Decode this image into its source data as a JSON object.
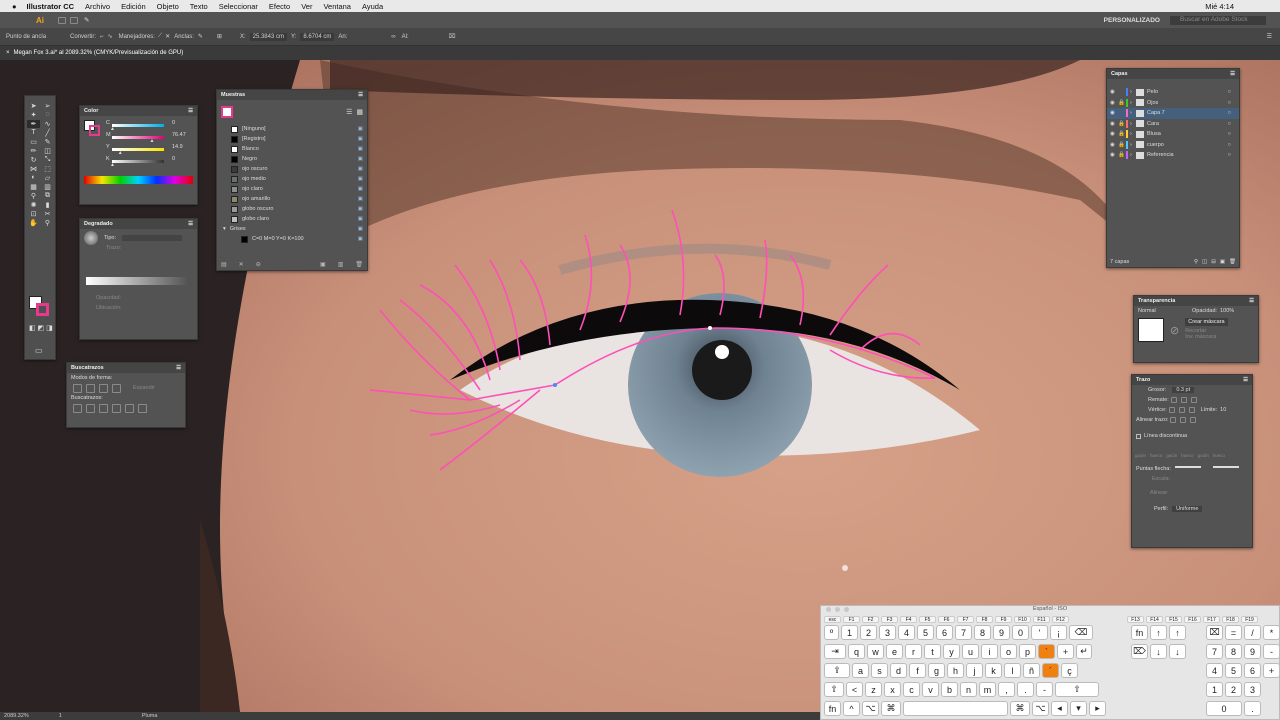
{
  "menubar": {
    "app": "Illustrator CC",
    "items": [
      "Archivo",
      "Edición",
      "Objeto",
      "Texto",
      "Seleccionar",
      "Efecto",
      "Ver",
      "Ventana",
      "Ayuda"
    ],
    "clock": "Mié 4:14"
  },
  "ctrlbar": {
    "app_icon": "Ai",
    "workspace": "PERSONALIZADO",
    "stock_placeholder": "Buscar en Adobe Stock"
  },
  "optbar": {
    "anchor_label": "Punto de ancla",
    "convert_label": "Convertir:",
    "handles_label": "Manejadores:",
    "anchors_label": "Anclas:",
    "x_label": "X:",
    "x_value": "25.3843 cm",
    "y_label": "Y:",
    "y_value": "8.6704 cm",
    "w_label": "An:",
    "h_label": "Al:"
  },
  "doc": {
    "tab": "Megan Fox 3.ai* al 2089.32% (CMYK/Previsualización de GPU)"
  },
  "status": {
    "zoom": "2089.32%",
    "page": "1",
    "tool": "Pluma"
  },
  "color_panel": {
    "title": "Color",
    "channels": [
      {
        "label": "C",
        "value": "0",
        "frac": 0.0,
        "color": "#00aee8"
      },
      {
        "label": "M",
        "value": "76.47",
        "frac": 0.76,
        "color": "#e0007a"
      },
      {
        "label": "Y",
        "value": "14.9",
        "frac": 0.15,
        "color": "#f2e500"
      },
      {
        "label": "K",
        "value": "0",
        "frac": 0.0,
        "color": "#333333"
      }
    ]
  },
  "gradient_panel": {
    "title": "Degradado",
    "type_label": "Tipo:",
    "stroke_label": "Trazo:",
    "opacity_label": "Opacidad:",
    "location_label": "Ubicación:"
  },
  "pathfinder": {
    "title": "Buscatrazos",
    "shape_modes": "Modos de forma:",
    "expand": "Expandir",
    "pathfinders": "Buscatrazos:"
  },
  "swatches": {
    "title": "Muestras",
    "items": [
      {
        "name": "[Ninguno]",
        "color": "#ffffff"
      },
      {
        "name": "[Registro]",
        "color": "#000000"
      },
      {
        "name": "Blanco",
        "color": "#ffffff"
      },
      {
        "name": "Negro",
        "color": "#000000"
      },
      {
        "name": "ojo oscuro",
        "color": "#3b3b3b"
      },
      {
        "name": "ojo medio",
        "color": "#6b6f72"
      },
      {
        "name": "ojo claro",
        "color": "#8b8f8c"
      },
      {
        "name": "ojo amarillo",
        "color": "#8d8a6a"
      },
      {
        "name": "globo oscuro",
        "color": "#9a9a9a"
      },
      {
        "name": "globo claro",
        "color": "#bdbdbd"
      },
      {
        "name": "Grises",
        "color": "#535353"
      },
      {
        "name": "C=0 M=0 Y=0 K=100",
        "color": "#000000"
      }
    ]
  },
  "layers": {
    "title": "Capas",
    "items": [
      "Pelo",
      "Ojos",
      "Capa 7",
      "Cara",
      "Blusa",
      "cuerpo",
      "Referencia"
    ],
    "bar_colors": [
      "#4a7cff",
      "#33cc33",
      "#ff66cc",
      "#ff6a6a",
      "#ffcc33",
      "#4ac8ff",
      "#bb66ff"
    ],
    "count": "7 capas"
  },
  "transparency": {
    "title": "Transparencia",
    "mode": "Normal",
    "opacity_label": "Opacidad:",
    "opacity": "100%",
    "mask_button": "Crear máscara",
    "clip_label": "Recortar",
    "invert_label": "Inv. máscara"
  },
  "stroke": {
    "title": "Trazo",
    "weight_label": "Grosor:",
    "weight": "0.3 pt",
    "cap_label": "Remate:",
    "corner_label": "Vértice:",
    "limit_label": "Límite:",
    "limit": "10",
    "align_label": "Alinear trazo:",
    "dashed_label": "Línea discontinua",
    "dash_labels": [
      "guión",
      "hueco",
      "guión",
      "hueco",
      "guión",
      "hueco"
    ],
    "arrows_label": "Puntas flecha:",
    "scale_label": "Escala:",
    "align2_label": "Alinear:",
    "profile_label": "Perfil:",
    "profile": "Uniforme"
  },
  "keyboard": {
    "title": "Español - ISO",
    "fn": [
      "esc",
      "F1",
      "F2",
      "F3",
      "F4",
      "F5",
      "F6",
      "F7",
      "F8",
      "F9",
      "F10",
      "F11",
      "F12"
    ],
    "fn_right": [
      "F13",
      "F14",
      "F15",
      "F16",
      "F17",
      "F18",
      "F19"
    ],
    "row1": [
      "º",
      "1",
      "2",
      "3",
      "4",
      "5",
      "6",
      "7",
      "8",
      "9",
      "0",
      "'",
      "¡",
      "⌫"
    ],
    "row2": [
      "⇥",
      "q",
      "w",
      "e",
      "r",
      "t",
      "y",
      "u",
      "i",
      "o",
      "p",
      "`",
      "+",
      "↵"
    ],
    "row3": [
      "⇪",
      "a",
      "s",
      "d",
      "f",
      "g",
      "h",
      "j",
      "k",
      "l",
      "ñ",
      "´",
      "ç"
    ],
    "row4": [
      "⇧",
      "<",
      "z",
      "x",
      "c",
      "v",
      "b",
      "n",
      "m",
      ",",
      ".",
      "-",
      "⇧"
    ],
    "row5": [
      "fn",
      "^",
      "⌥",
      "⌘",
      "",
      "⌘",
      "⌥",
      "◂",
      "▾",
      "▸"
    ],
    "nav1": [
      "fn",
      "↑",
      "↑"
    ],
    "nav2": [
      "⌦",
      "↓",
      "↓"
    ],
    "num1": [
      "⌧",
      "=",
      "/",
      "*"
    ],
    "num2": [
      "7",
      "8",
      "9",
      "-"
    ],
    "num3": [
      "4",
      "5",
      "6",
      "+"
    ],
    "num4": [
      "1",
      "2",
      "3"
    ],
    "num5": [
      "0",
      "."
    ]
  }
}
